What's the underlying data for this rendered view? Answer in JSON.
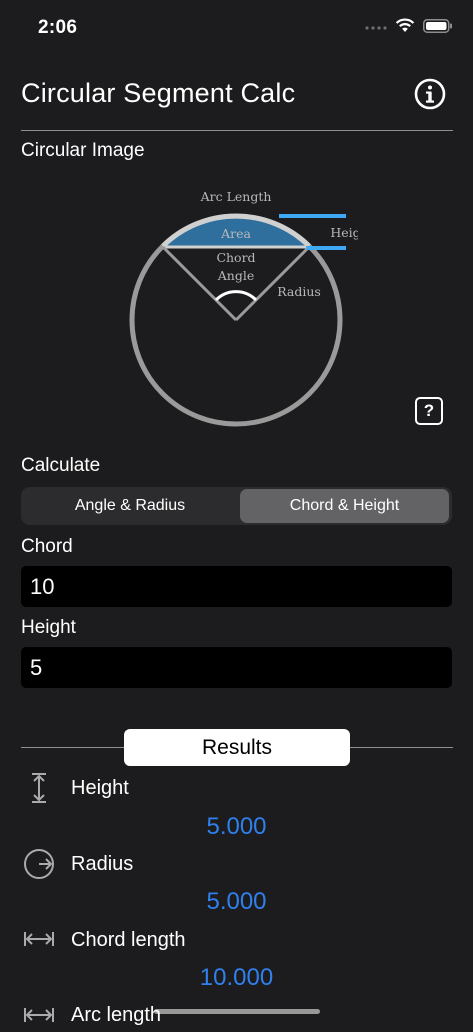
{
  "status": {
    "time": "2:06"
  },
  "header": {
    "title": "Circular Segment Calc"
  },
  "image_section": {
    "label": "Circular Image"
  },
  "diagram": {
    "arc_length": "Arc Length",
    "height": "Height",
    "area": "Area",
    "chord_line1": "Chord",
    "chord_line2": "Angle",
    "radius": "Radius"
  },
  "help_button": {
    "label": "?"
  },
  "calculate": {
    "label": "Calculate",
    "options": [
      "Angle & Radius",
      "Chord & Height"
    ],
    "selected": "Chord & Height"
  },
  "inputs": {
    "chord_label": "Chord",
    "chord_value": "10",
    "height_label": "Height",
    "height_value": "5"
  },
  "results": {
    "title": "Results",
    "items": [
      {
        "label": "Height",
        "value": "5.000",
        "icon": "height-arrow-icon"
      },
      {
        "label": "Radius",
        "value": "5.000",
        "icon": "radius-circle-icon"
      },
      {
        "label": "Chord length",
        "value": "10.000",
        "icon": "chord-arrow-icon"
      },
      {
        "label": "Arc length",
        "icon": "arc-arrow-icon"
      }
    ]
  },
  "colors": {
    "accent": "#2f80ed",
    "background": "#1c1c1e",
    "segment_area": "#2e6f9e",
    "highlight": "#3fa9f5"
  }
}
